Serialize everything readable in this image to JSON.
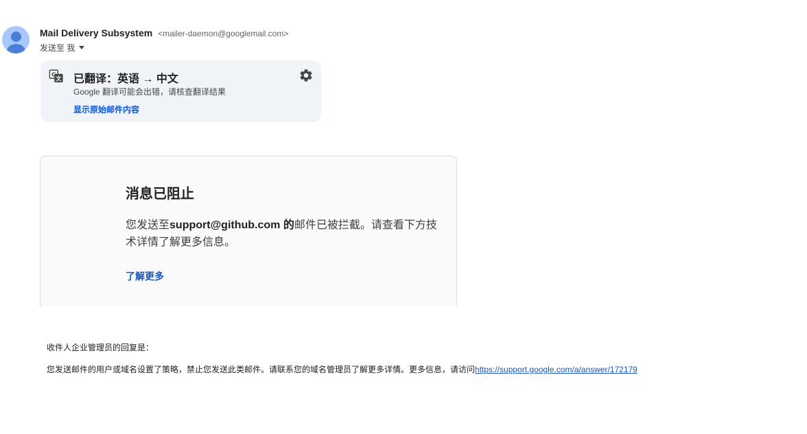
{
  "header": {
    "sender_name": "Mail Delivery Subsystem",
    "sender_email": "<mailer-daemon@googlemail.com>",
    "to_label": "发送至 我"
  },
  "translation": {
    "title": "已翻译：英语 → 中文",
    "note": "Google 翻译可能会出错，请核查翻译结果",
    "show_original": "显示原始邮件内容"
  },
  "blocked": {
    "title": "消息已阻止",
    "desc_prefix": "您发送至",
    "desc_address": "support@github.com 的",
    "desc_suffix": "邮件已被拦截。请查看下方技术详情了解更多信息。",
    "learn_more": "了解更多"
  },
  "admin": {
    "label": "收件人企业管理员的回复是：",
    "text": "您发送邮件的用户或域名设置了策略，禁止您发送此类邮件。请联系您的域名管理员了解更多详情。更多信息，请访问",
    "link": "https://support.google.com/a/answer/172179"
  },
  "colors": {
    "link": "#0b57d0",
    "banner_bg": "#f0f4f9",
    "avatar_bg": "#a8c7fa"
  },
  "icons": {
    "avatar": "person-icon",
    "translate": "translate-icon",
    "settings": "gear-icon",
    "dropdown": "caret-down-icon"
  }
}
